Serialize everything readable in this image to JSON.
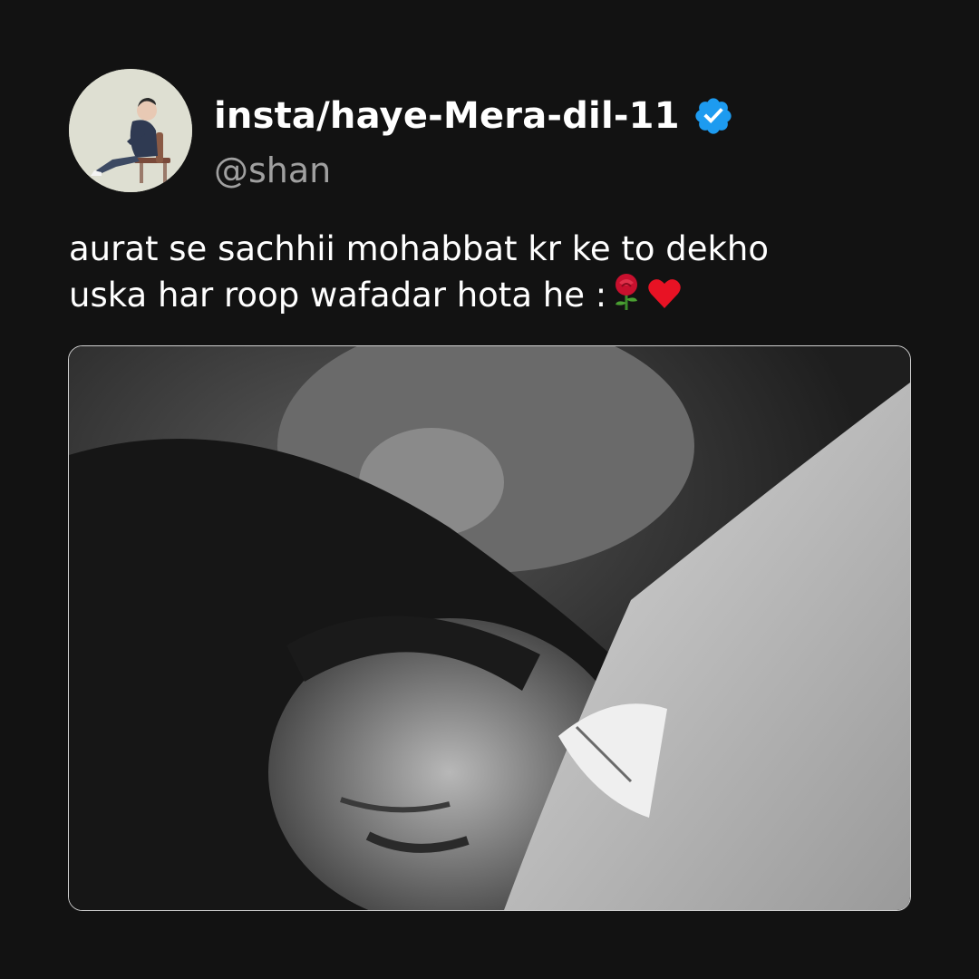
{
  "profile": {
    "display_name": "insta/haye-Mera-dil-11",
    "handle": "@shan",
    "verified": true,
    "verified_icon": "verified-badge-icon",
    "avatar_icon": "avatar-illustration"
  },
  "tweet": {
    "line1": "aurat se sachhii mohabbat kr ke to dekho",
    "line2": "uska har roop wafadar hota he :",
    "emojis": [
      "rose-emoji",
      "red-heart-emoji"
    ]
  },
  "media": {
    "description_icon": "couple-photo"
  },
  "colors": {
    "background": "#121212",
    "text": "#ffffff",
    "handle": "#a0a0a0",
    "verified": "#1d9bf0",
    "media_border": "#cfcfcf"
  }
}
